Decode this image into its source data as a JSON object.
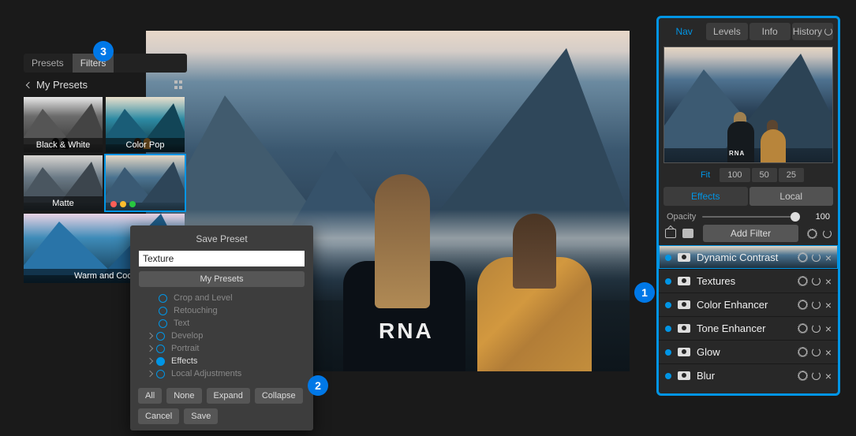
{
  "badges": {
    "b1": "1",
    "b2": "2",
    "b3": "3"
  },
  "leftPanel": {
    "tabs": {
      "presets": "Presets",
      "filters": "Filters"
    },
    "headerTitle": "My Presets",
    "thumbs": {
      "bw": "Black & White",
      "cp": "Color Pop",
      "mt": "Matte",
      "wc": "Warm and Cool"
    }
  },
  "dialog": {
    "title": "Save Preset",
    "inputValue": "Texture",
    "categoryBtn": "My Presets",
    "items": {
      "crop": "Crop and Level",
      "retouch": "Retouching",
      "text": "Text",
      "develop": "Develop",
      "portrait": "Portrait",
      "effects": "Effects",
      "local": "Local Adjustments"
    },
    "buttons": {
      "all": "All",
      "none": "None",
      "expand": "Expand",
      "collapse": "Collapse",
      "cancel": "Cancel",
      "save": "Save"
    }
  },
  "rightPanel": {
    "tabs": {
      "nav": "Nav",
      "levels": "Levels",
      "info": "Info",
      "history": "History"
    },
    "zoom": {
      "fit": "Fit",
      "z100": "100",
      "z50": "50",
      "z25": "25"
    },
    "seg": {
      "effects": "Effects",
      "local": "Local"
    },
    "opacityLabel": "Opacity",
    "opacityValue": "100",
    "addFilter": "Add Filter",
    "filters": {
      "f1": "Dynamic Contrast",
      "f2": "Textures",
      "f3": "Color Enhancer",
      "f4": "Tone Enhancer",
      "f5": "Glow",
      "f6": "Blur"
    }
  },
  "canvas": {
    "shirtText": "RNA",
    "navShirtText": "RNA"
  }
}
